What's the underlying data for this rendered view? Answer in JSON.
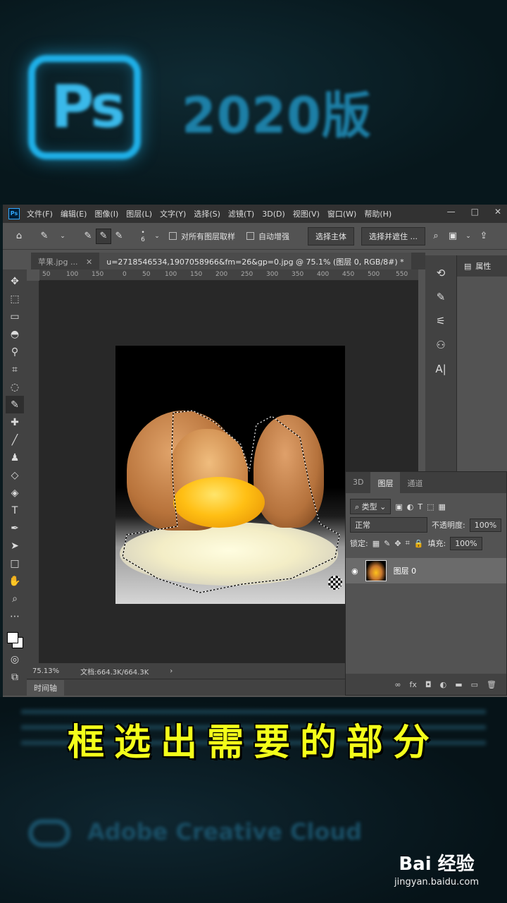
{
  "banner": {
    "logo_text": "Ps",
    "title": "2020版"
  },
  "menubar": {
    "app_icon": "Ps",
    "items": [
      "文件(F)",
      "编辑(E)",
      "图像(I)",
      "图层(L)",
      "文字(Y)",
      "选择(S)",
      "滤镜(T)",
      "3D(D)",
      "视图(V)",
      "窗口(W)",
      "帮助(H)"
    ],
    "window_controls": [
      "—",
      "□",
      "✕"
    ]
  },
  "options": {
    "brush_size": "6",
    "sample_all_layers": "对所有图层取样",
    "auto_enhance": "自动增强",
    "select_subject": "选择主体",
    "select_and_mask": "选择并遮住 ..."
  },
  "tabs": [
    {
      "label": "苹果.jpg ...",
      "close": "✕"
    },
    {
      "label": "u=2718546534,1907058966&fm=26&gp=0.jpg @ 75.1% (图层 0, RGB/8#) *",
      "close": "✕"
    }
  ],
  "ruler_ticks": [
    "50",
    "100",
    "150",
    "0",
    "50",
    "100",
    "150",
    "200",
    "250",
    "300",
    "350",
    "400",
    "450",
    "500",
    "550"
  ],
  "status": {
    "zoom": "75.13%",
    "doc": "文档:664.3K/664.3K",
    "arrow": "›"
  },
  "timeline": "时间轴",
  "properties": {
    "title": "属性"
  },
  "layers_panel": {
    "tabs": [
      "3D",
      "图层",
      "通道"
    ],
    "kind_filter": "类型",
    "blend_mode": "正常",
    "opacity_label": "不透明度:",
    "opacity_value": "100%",
    "lock_label": "锁定:",
    "fill_label": "填充:",
    "fill_value": "100%",
    "layer_name": "图层 0",
    "footer_icons": [
      "∞",
      "fx",
      "◘",
      "◐",
      "▬",
      "▭",
      "🗑"
    ]
  },
  "caption": "框选出需要的部分",
  "creative_cloud": "Adobe Creative Cloud",
  "watermark": {
    "logo": "Bai 经验",
    "url": "jingyan.baidu.com"
  },
  "colors": {
    "ps_blue": "#31a8ff",
    "caption_yellow": "#f4ff1a",
    "panel_dark": "#323232",
    "panel_mid": "#535353"
  }
}
